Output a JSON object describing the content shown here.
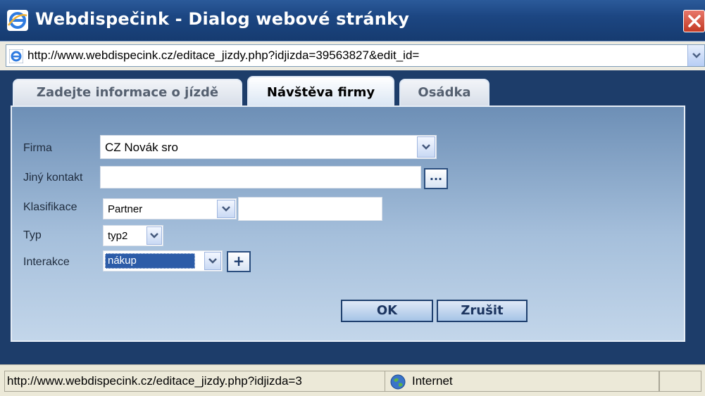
{
  "window": {
    "title": "Webdispečink - Dialog webové stránky"
  },
  "address": {
    "url": "http://www.webdispecink.cz/editace_jizdy.php?idjizda=39563827&edit_id="
  },
  "tabs": [
    {
      "label": "Zadejte informace o jízdě",
      "active": false
    },
    {
      "label": "Návštěva firmy",
      "active": true
    },
    {
      "label": "Osádka",
      "active": false
    }
  ],
  "form": {
    "firma": {
      "label": "Firma",
      "value": "CZ Novák sro"
    },
    "jiny_kontakt": {
      "label": "Jiný kontakt",
      "value": "",
      "browse_label": "..."
    },
    "klasifikace": {
      "label": "Klasifikace",
      "value": "Partner",
      "extra_value": ""
    },
    "typ": {
      "label": "Typ",
      "value": "typ2"
    },
    "interakce": {
      "label": "Interakce",
      "value": "nákup",
      "add_label": "+"
    }
  },
  "buttons": {
    "ok": "OK",
    "cancel": "Zrušit"
  },
  "status": {
    "url": "http://www.webdispecink.cz/editace_jizdy.php?idjizda=3",
    "zone": "Internet"
  }
}
